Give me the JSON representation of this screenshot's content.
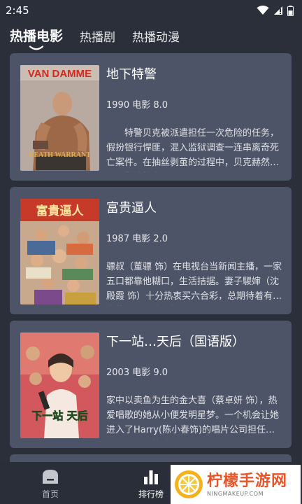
{
  "status_bar": {
    "time": "2:45",
    "icons": [
      "wifi-icon",
      "signal-icon",
      "battery-icon"
    ]
  },
  "tabs": [
    {
      "label": "热播电影",
      "active": true
    },
    {
      "label": "热播剧",
      "active": false
    },
    {
      "label": "热播动漫",
      "active": false
    }
  ],
  "movies": [
    {
      "title": "地下特警",
      "meta": "1990 电影 8.0",
      "description": "　　特警贝克被派遣担任一次危险的任务，假扮银行悍匪，混入监狱调查一连串离奇死亡案件。在抽丝剥茧的过程中，贝克赫然发现狱警狄格夫原来串…",
      "poster": {
        "top_text": "VAN DAMME",
        "bottom_text": "DEATH WARRANT"
      }
    },
    {
      "title": "富贵逼人",
      "meta": "1987 电影 2.0",
      "description": "骠叔（董骠 饰）在电视台当新闻主播，一家五口都靠他糊口，生活拮据。妻子騣婶（沈殿霞 饰）十分热衷买六合彩，总期待着有中奖的一天。他们每天都…",
      "poster": {
        "top_text": "富貴逼人"
      }
    },
    {
      "title": "下一站…天后（国语版）",
      "meta": "2003 电影 9.0",
      "description": "家中以卖鱼为生的金大喜（蔡卓妍 饰），热爱唱歌的她从小便发明星梦。一个机会让她进入了Harry(陈小春饰)的唱片公司担任歌手Shadow的助手。加…",
      "poster": {
        "bottom_text": "下一站 天后"
      }
    }
  ],
  "bottom_nav": [
    {
      "label": "首页",
      "icon": "home-icon",
      "active": false
    },
    {
      "label": "排行榜",
      "icon": "ranking-icon",
      "active": true
    }
  ],
  "watermark": {
    "name": "柠檬手游网",
    "url": "NINGMAKEUP.COM"
  }
}
